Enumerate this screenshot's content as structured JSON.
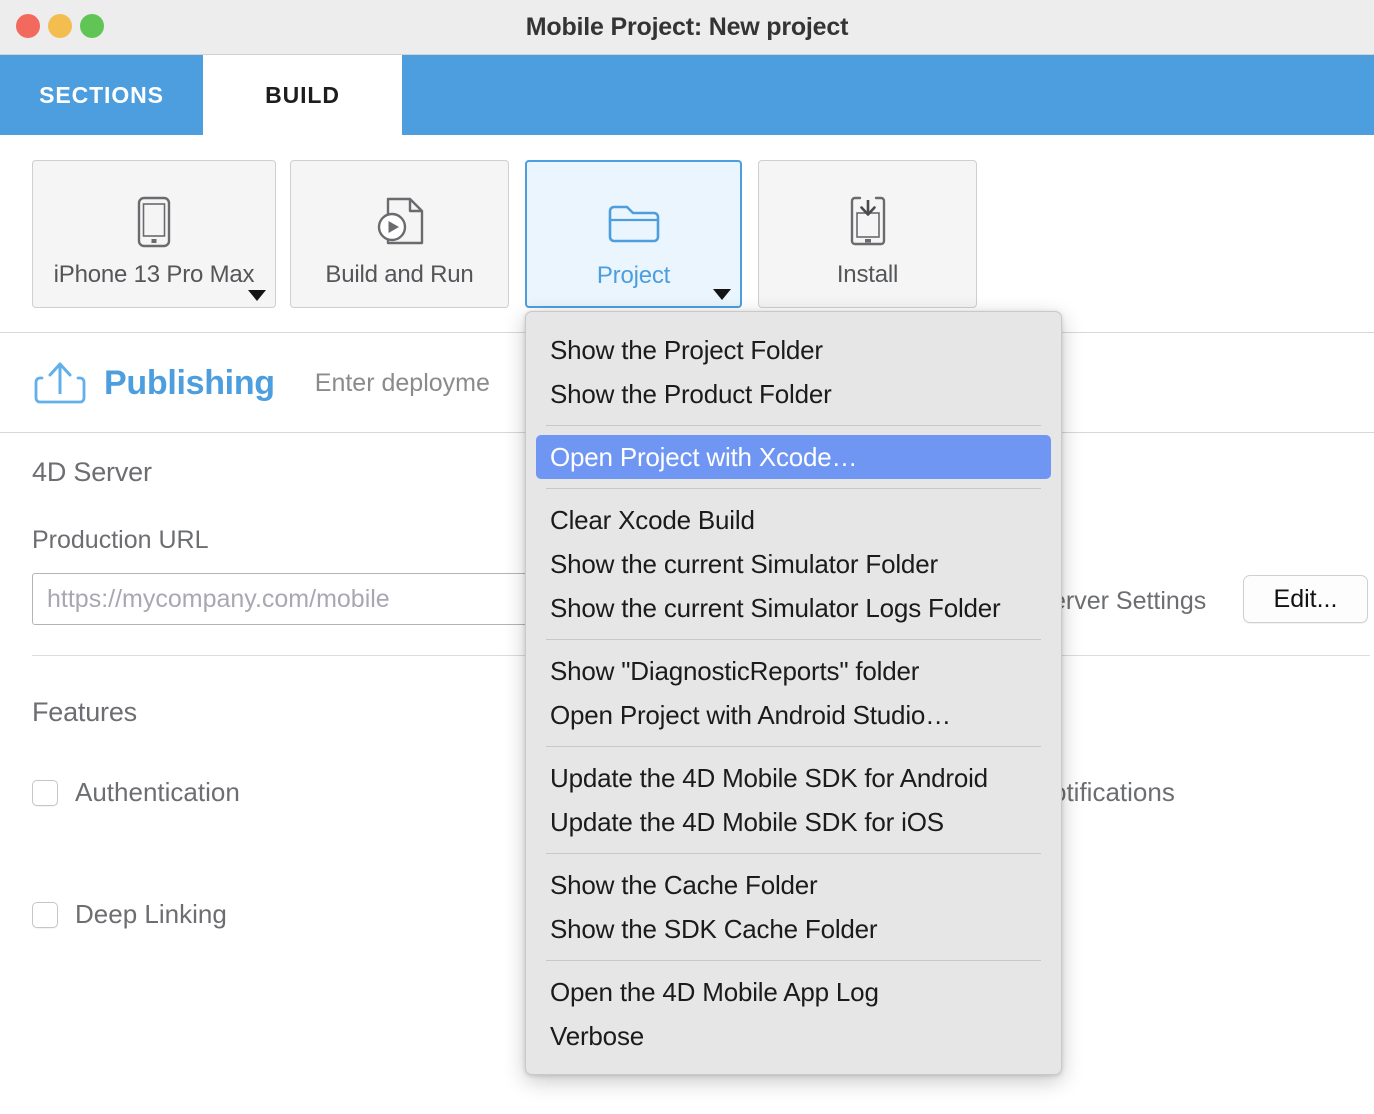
{
  "window": {
    "title": "Mobile Project: New project",
    "traffic_lights": [
      "close",
      "minimize",
      "maximize"
    ]
  },
  "tabs": [
    {
      "id": "sections",
      "label": "SECTIONS",
      "active": false
    },
    {
      "id": "build",
      "label": "BUILD",
      "active": true
    }
  ],
  "toolbar": {
    "buttons": [
      {
        "id": "device",
        "label": "iPhone 13 Pro Max",
        "icon": "phone-icon",
        "has_caret": true,
        "selected": false
      },
      {
        "id": "build-run",
        "label": "Build and Run",
        "icon": "document-play-icon",
        "has_caret": false,
        "selected": false
      },
      {
        "id": "project",
        "label": "Project",
        "icon": "folder-icon",
        "has_caret": true,
        "selected": true
      },
      {
        "id": "install",
        "label": "Install",
        "icon": "phone-download-icon",
        "has_caret": false,
        "selected": false
      }
    ]
  },
  "publishing": {
    "icon": "share-upload-icon",
    "title": "Publishing",
    "hint": "Enter deployme"
  },
  "server_section": {
    "heading": "4D Server",
    "url_label": "Production URL",
    "url_value": "",
    "url_placeholder": "https://mycompany.com/mobile",
    "settings_label": "erver Settings",
    "edit_button": "Edit..."
  },
  "features_section": {
    "heading": "Features",
    "items": [
      {
        "id": "authentication",
        "label": "Authentication",
        "checked": false
      },
      {
        "id": "notifications",
        "label": "otifications",
        "checked": false
      },
      {
        "id": "deep-linking",
        "label": "Deep Linking",
        "checked": false
      }
    ]
  },
  "project_menu": {
    "groups": [
      {
        "items": [
          {
            "id": "show-project-folder",
            "label": "Show the Project Folder",
            "highlighted": false
          },
          {
            "id": "show-product-folder",
            "label": "Show the Product Folder",
            "highlighted": false
          }
        ]
      },
      {
        "items": [
          {
            "id": "open-project-xcode",
            "label": "Open Project with Xcode…",
            "highlighted": true
          }
        ]
      },
      {
        "items": [
          {
            "id": "clear-xcode-build",
            "label": "Clear Xcode Build",
            "highlighted": false
          },
          {
            "id": "show-simulator-folder",
            "label": "Show the current Simulator Folder",
            "highlighted": false
          },
          {
            "id": "show-simulator-logs-folder",
            "label": "Show the current Simulator Logs Folder",
            "highlighted": false
          }
        ]
      },
      {
        "items": [
          {
            "id": "show-diagnosticreports-folder",
            "label": "Show \"DiagnosticReports\" folder",
            "highlighted": false
          },
          {
            "id": "open-project-android-studio",
            "label": "Open Project with Android Studio…",
            "highlighted": false
          }
        ]
      },
      {
        "items": [
          {
            "id": "update-sdk-android",
            "label": "Update the 4D Mobile SDK for Android",
            "highlighted": false
          },
          {
            "id": "update-sdk-ios",
            "label": "Update the 4D Mobile SDK for iOS",
            "highlighted": false
          }
        ]
      },
      {
        "items": [
          {
            "id": "show-cache-folder",
            "label": "Show the Cache Folder",
            "highlighted": false
          },
          {
            "id": "show-sdk-cache-folder",
            "label": "Show the SDK Cache Folder",
            "highlighted": false
          }
        ]
      },
      {
        "items": [
          {
            "id": "open-app-log",
            "label": "Open the 4D Mobile App Log",
            "highlighted": false
          },
          {
            "id": "verbose",
            "label": "Verbose",
            "highlighted": false
          }
        ]
      }
    ]
  },
  "colors": {
    "tab_blue": "#4d9edf",
    "accent_blue": "#4d9edf",
    "menu_highlight": "#6f96f3",
    "menu_background": "#e6e6e6",
    "titlebar": "#ecedec",
    "close_light": "#f3695e",
    "minimize_light": "#f4bd4f",
    "maximize_light": "#61c555"
  }
}
